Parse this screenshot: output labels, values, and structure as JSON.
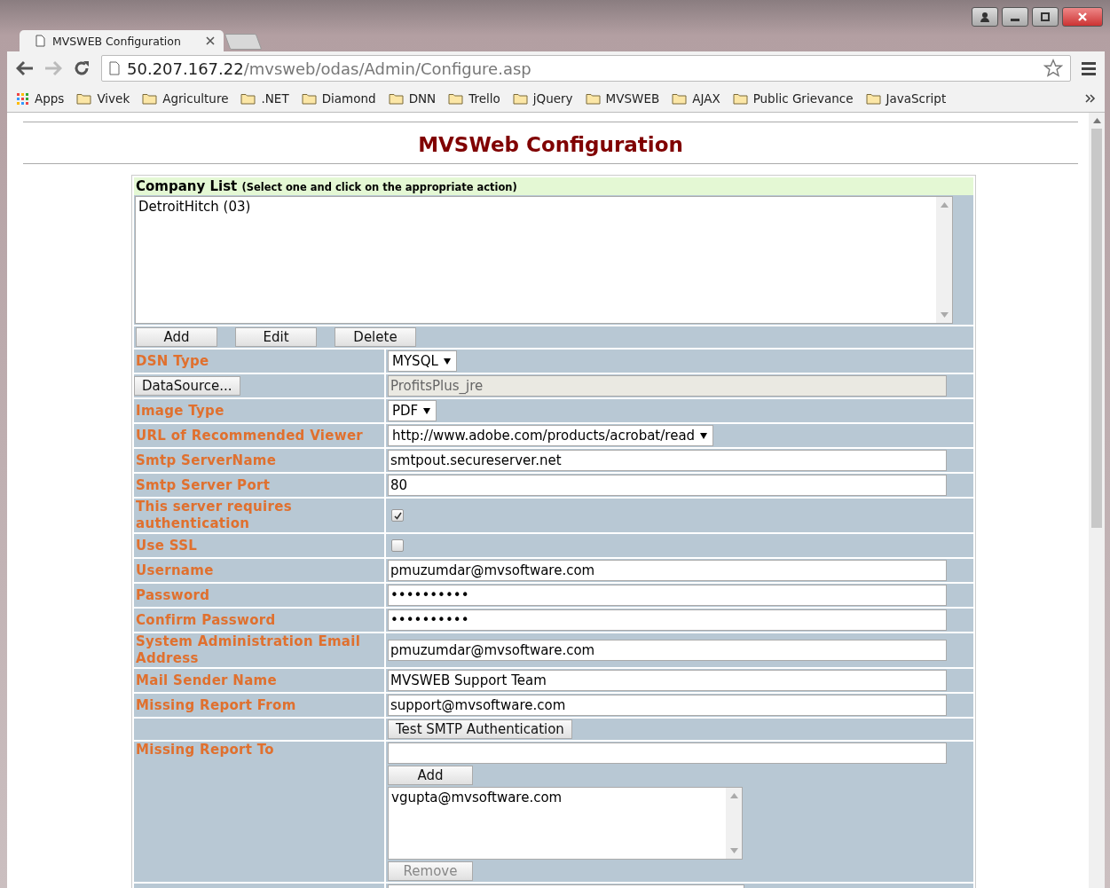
{
  "browser": {
    "tabs": [
      {
        "title": "MVSWEB Configuration",
        "selected": true
      }
    ],
    "address": {
      "host": "50.207.167.22",
      "path": "/mvsweb/odas/Admin/Configure.asp"
    },
    "bookmarks": [
      {
        "label": "Apps",
        "kind": "apps"
      },
      {
        "label": "Vivek",
        "kind": "folder"
      },
      {
        "label": "Agriculture",
        "kind": "folder"
      },
      {
        "label": ".NET",
        "kind": "folder"
      },
      {
        "label": "Diamond",
        "kind": "folder"
      },
      {
        "label": "DNN",
        "kind": "folder"
      },
      {
        "label": "Trello",
        "kind": "folder"
      },
      {
        "label": "jQuery",
        "kind": "folder"
      },
      {
        "label": "MVSWEB",
        "kind": "folder"
      },
      {
        "label": "AJAX",
        "kind": "folder"
      },
      {
        "label": "Public Grievance",
        "kind": "folder"
      },
      {
        "label": "JavaScript",
        "kind": "folder"
      }
    ]
  },
  "page": {
    "title": "MVSWeb Configuration",
    "company_list": {
      "title": "Company List",
      "hint": "(Select one and click on the appropriate action)",
      "items": [
        {
          "label": "DetroitHitch (03)",
          "selected": false
        }
      ],
      "buttons": [
        "Add",
        "Edit",
        "Delete"
      ]
    },
    "rows": [
      {
        "kind": "select",
        "label": "DSN Type",
        "value": "MYSQL"
      },
      {
        "kind": "button-field",
        "button": "DataSource...",
        "value": "ProfitsPlus_jre",
        "readonly": true
      },
      {
        "kind": "select",
        "label": "Image Type",
        "value": "PDF"
      },
      {
        "kind": "select",
        "label": "URL of Recommended Viewer",
        "value": "http://www.adobe.com/products/acrobat/read"
      },
      {
        "kind": "text",
        "label": "Smtp ServerName",
        "value": "smtpout.secureserver.net",
        "readonly": false
      },
      {
        "kind": "text",
        "label": "Smtp Server Port",
        "value": "80",
        "readonly": false
      },
      {
        "kind": "checkbox",
        "label": "This server requires authentication",
        "checked": true
      },
      {
        "kind": "checkbox",
        "label": "Use SSL",
        "checked": false
      },
      {
        "kind": "text",
        "label": "Username",
        "value": "pmuzumdar@mvsoftware.com",
        "readonly": false
      },
      {
        "kind": "text",
        "label": "Password",
        "value": "••••••••••",
        "readonly": false
      },
      {
        "kind": "text",
        "label": "Confirm Password",
        "value": "••••••••••",
        "readonly": false
      },
      {
        "kind": "text",
        "label": "System Administration Email Address",
        "value": "pmuzumdar@mvsoftware.com",
        "readonly": false
      },
      {
        "kind": "text",
        "label": "Mail Sender Name",
        "value": "MVSWEB Support Team",
        "readonly": false
      },
      {
        "kind": "text",
        "label": "Missing Report From",
        "value": "support@mvsoftware.com",
        "readonly": false
      },
      {
        "kind": "button",
        "button": "Test SMTP Authentication"
      },
      {
        "kind": "list-entry",
        "label": "Missing Report To",
        "add_button": "Add",
        "items": [
          {
            "label": "vgupta@mvsoftware.com",
            "selected": false
          }
        ],
        "remove_button": {
          "label": "Remove",
          "disabled": true
        }
      },
      {
        "kind": "cut-field"
      }
    ]
  }
}
